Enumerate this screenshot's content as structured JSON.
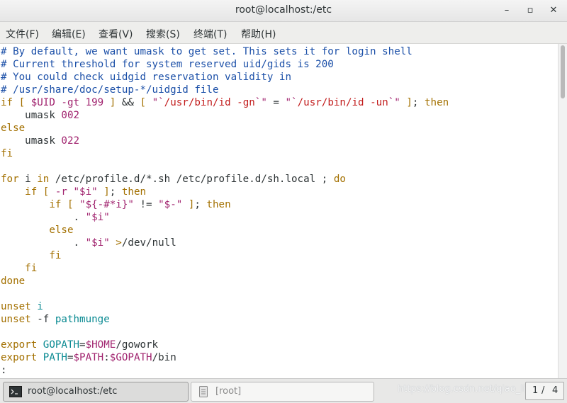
{
  "window": {
    "title": "root@localhost:/etc",
    "minimize_glyph": "–",
    "maximize_glyph": "▫",
    "close_glyph": "✕"
  },
  "menu": [
    {
      "label": "文件(F)"
    },
    {
      "label": "编辑(E)"
    },
    {
      "label": "查看(V)"
    },
    {
      "label": "搜索(S)"
    },
    {
      "label": "终端(T)"
    },
    {
      "label": "帮助(H)"
    }
  ],
  "terminal": {
    "lines": [
      [
        {
          "t": "# By default, we want umask to get set. This sets it for login shell",
          "c": "comment"
        }
      ],
      [
        {
          "t": "# Current threshold for system reserved uid/gids is 200",
          "c": "comment"
        }
      ],
      [
        {
          "t": "# You could check uidgid reservation validity in",
          "c": "comment"
        }
      ],
      [
        {
          "t": "# /usr/share/doc/setup-*/uidgid file",
          "c": "comment"
        }
      ],
      [
        {
          "t": "if [ ",
          "c": "kw"
        },
        {
          "t": "$UID",
          "c": "var"
        },
        {
          "t": " -gt 199 ",
          "c": "var"
        },
        {
          "t": "]",
          "c": "kw"
        },
        {
          "t": " && ",
          "c": "text"
        },
        {
          "t": "[ ",
          "c": "kw"
        },
        {
          "t": "\"`",
          "c": "var"
        },
        {
          "t": "/usr/bin/id -gn",
          "c": "str"
        },
        {
          "t": "`\"",
          "c": "var"
        },
        {
          "t": " = ",
          "c": "text"
        },
        {
          "t": "\"`",
          "c": "var"
        },
        {
          "t": "/usr/bin/id -un",
          "c": "str"
        },
        {
          "t": "`\"",
          "c": "var"
        },
        {
          "t": " ]",
          "c": "kw"
        },
        {
          "t": "; ",
          "c": "text"
        },
        {
          "t": "then",
          "c": "kw"
        }
      ],
      [
        {
          "t": "    umask ",
          "c": "text"
        },
        {
          "t": "002",
          "c": "var"
        }
      ],
      [
        {
          "t": "else",
          "c": "kw"
        }
      ],
      [
        {
          "t": "    umask ",
          "c": "text"
        },
        {
          "t": "022",
          "c": "var"
        }
      ],
      [
        {
          "t": "fi",
          "c": "kw"
        }
      ],
      [
        {
          "t": "",
          "c": "text"
        }
      ],
      [
        {
          "t": "for",
          "c": "kw"
        },
        {
          "t": " i ",
          "c": "text"
        },
        {
          "t": "in",
          "c": "kw"
        },
        {
          "t": " /etc/profile.d/*.sh /etc/profile.d/sh.local ; ",
          "c": "text"
        },
        {
          "t": "do",
          "c": "kw"
        }
      ],
      [
        {
          "t": "    ",
          "c": "text"
        },
        {
          "t": "if [ ",
          "c": "kw"
        },
        {
          "t": "-r ",
          "c": "var"
        },
        {
          "t": "\"$i\"",
          "c": "var"
        },
        {
          "t": " ]",
          "c": "kw"
        },
        {
          "t": "; ",
          "c": "text"
        },
        {
          "t": "then",
          "c": "kw"
        }
      ],
      [
        {
          "t": "        ",
          "c": "text"
        },
        {
          "t": "if [ ",
          "c": "kw"
        },
        {
          "t": "\"${-#*i}\"",
          "c": "var"
        },
        {
          "t": " != ",
          "c": "text"
        },
        {
          "t": "\"$-\"",
          "c": "var"
        },
        {
          "t": " ]",
          "c": "kw"
        },
        {
          "t": "; ",
          "c": "text"
        },
        {
          "t": "then",
          "c": "kw"
        }
      ],
      [
        {
          "t": "            . ",
          "c": "text"
        },
        {
          "t": "\"$i\"",
          "c": "var"
        }
      ],
      [
        {
          "t": "        else",
          "c": "kw"
        }
      ],
      [
        {
          "t": "            . ",
          "c": "text"
        },
        {
          "t": "\"$i\"",
          "c": "var"
        },
        {
          "t": " >",
          "c": "kw"
        },
        {
          "t": "/dev/null",
          "c": "text"
        }
      ],
      [
        {
          "t": "        fi",
          "c": "kw"
        }
      ],
      [
        {
          "t": "    fi",
          "c": "kw"
        }
      ],
      [
        {
          "t": "done",
          "c": "kw"
        }
      ],
      [
        {
          "t": "",
          "c": "text"
        }
      ],
      [
        {
          "t": "unset",
          "c": "kw"
        },
        {
          "t": " i",
          "c": "cyan"
        }
      ],
      [
        {
          "t": "unset",
          "c": "kw"
        },
        {
          "t": " -f ",
          "c": "text"
        },
        {
          "t": "pathmunge",
          "c": "cyan"
        }
      ],
      [
        {
          "t": "",
          "c": "text"
        }
      ],
      [
        {
          "t": "export",
          "c": "kw"
        },
        {
          "t": " GOPATH",
          "c": "cyan"
        },
        {
          "t": "=",
          "c": "text"
        },
        {
          "t": "$HOME",
          "c": "var"
        },
        {
          "t": "/gowork",
          "c": "text"
        }
      ],
      [
        {
          "t": "export",
          "c": "kw"
        },
        {
          "t": " PATH",
          "c": "cyan"
        },
        {
          "t": "=",
          "c": "text"
        },
        {
          "t": "$PATH",
          "c": "var"
        },
        {
          "t": ":",
          "c": "text"
        },
        {
          "t": "$GOPATH",
          "c": "var"
        },
        {
          "t": "/bin",
          "c": "text"
        }
      ],
      [
        {
          "t": ":",
          "c": "text"
        }
      ]
    ]
  },
  "taskbar": {
    "tasks": [
      {
        "label": "root@localhost:/etc",
        "icon": "terminal-icon",
        "active": true
      },
      {
        "label": "[root]",
        "icon": "file-manager-icon",
        "active": false
      }
    ],
    "pager": {
      "current": "1",
      "total": "4",
      "separator": "/"
    },
    "watermark": "https://blog.csdn.net/qiao_liang_"
  },
  "colors": {
    "comment": "#1c50a8",
    "keyword": "#a37000",
    "variable": "#a1246f",
    "string": "#c21c1c",
    "identifier": "#0a8a92",
    "text": "#2e3436"
  }
}
